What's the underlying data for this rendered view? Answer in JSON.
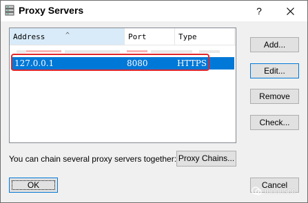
{
  "window": {
    "title": "Proxy Servers",
    "help_glyph": "?",
    "close_glyph": "✕",
    "icon": "server-icon"
  },
  "table": {
    "columns": [
      "Address",
      "Port",
      "Type"
    ],
    "sort_glyph": "^",
    "rows": [
      {
        "address": "127.0.0.1",
        "port": "8080",
        "type": "HTTPS",
        "selected": true
      }
    ]
  },
  "buttons": {
    "add": "Add...",
    "edit": "Edit...",
    "remove": "Remove",
    "check": "Check...",
    "proxy_chains": "Proxy Chains...",
    "ok": "OK",
    "cancel": "Cancel"
  },
  "chain_text": "You can chain several proxy servers together:",
  "watermark": "moonsec",
  "colors": {
    "selection": "#0078d7",
    "highlight_box": "#e0262a",
    "dialog_bg": "#f0f0f0"
  }
}
